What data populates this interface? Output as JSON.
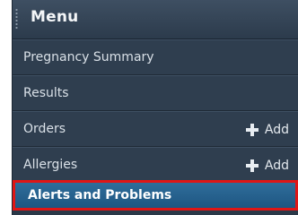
{
  "menu": {
    "title": "Menu",
    "items": [
      {
        "label": "Pregnancy Summary"
      },
      {
        "label": "Results"
      },
      {
        "label": "Orders",
        "action": {
          "label": "Add",
          "icon": "plus-icon"
        }
      },
      {
        "label": "Allergies",
        "action": {
          "label": "Add",
          "icon": "plus-icon"
        }
      }
    ],
    "active_item": {
      "label": "Alerts and Problems"
    }
  },
  "colors": {
    "panel": "#2b3a4b",
    "active": "#2f6d9a",
    "highlight": "#e01616"
  }
}
